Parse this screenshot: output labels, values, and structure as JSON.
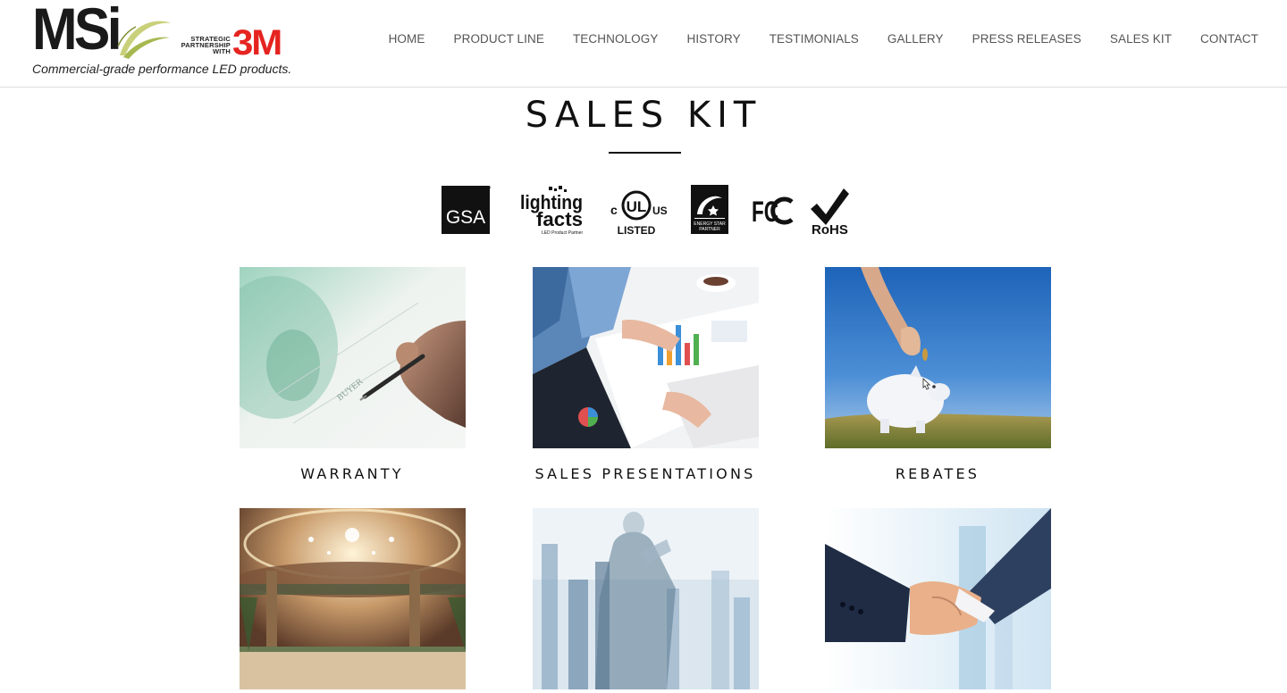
{
  "header": {
    "logo": {
      "brand": "MSi",
      "partner_text": [
        "STRATEGIC",
        "PARTNERSHIP",
        "WITH"
      ],
      "partner_brand": "3M",
      "tagline": "Commercial-grade performance LED products."
    },
    "nav": [
      "HOME",
      "PRODUCT LINE",
      "TECHNOLOGY",
      "HISTORY",
      "TESTIMONIALS",
      "GALLERY",
      "PRESS RELEASES",
      "SALES KIT",
      "CONTACT"
    ]
  },
  "page": {
    "title": "SALES KIT"
  },
  "certifications": [
    {
      "name": "gsa-logo",
      "text": "GSA"
    },
    {
      "name": "lighting-facts-logo",
      "text": "lighting facts",
      "subtext": "LED Product Partner"
    },
    {
      "name": "ul-listed-logo",
      "text": "UL",
      "left": "c",
      "right": "US",
      "bottom": "LISTED"
    },
    {
      "name": "energy-star-logo",
      "text": "ENERGY STAR PARTNER"
    },
    {
      "name": "fcc-logo",
      "text": "FC"
    },
    {
      "name": "rohs-logo",
      "text": "RoHS"
    }
  ],
  "tiles": [
    {
      "label": "WARRANTY",
      "image": "pen-signing-document"
    },
    {
      "label": "SALES PRESENTATIONS",
      "image": "business-charts-laptop"
    },
    {
      "label": "REBATES",
      "image": "piggy-bank-coin"
    },
    {
      "label": "",
      "image": "hotel-lobby-chandelier"
    },
    {
      "label": "",
      "image": "businessman-city-overlay"
    },
    {
      "label": "",
      "image": "business-handshake"
    }
  ],
  "colors": {
    "brand_red": "#e52420",
    "nav_text": "#555555",
    "swoosh_green": "#b8c46a"
  }
}
